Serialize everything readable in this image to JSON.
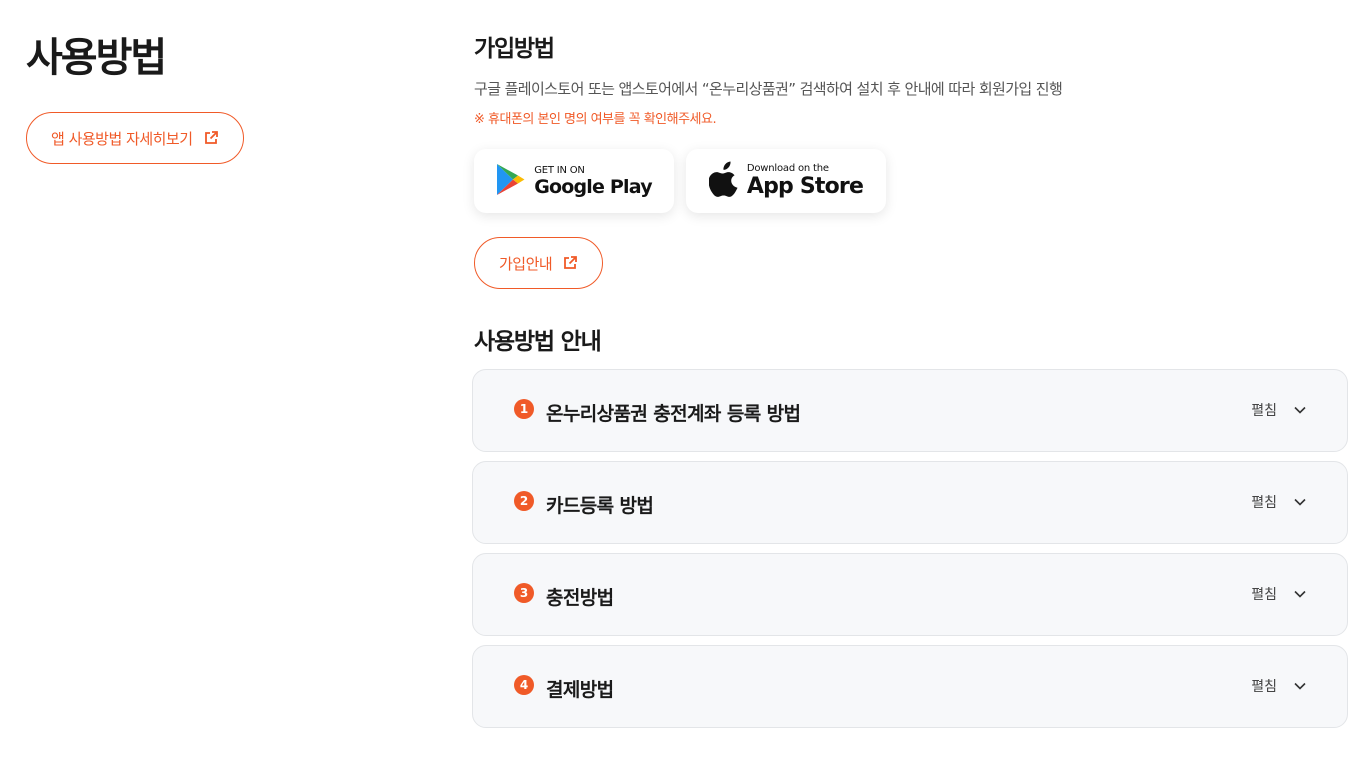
{
  "left": {
    "title": "사용방법",
    "detail_button": "앱 사용방법 자세히보기"
  },
  "signup": {
    "title": "가입방법",
    "description": "구글 플레이스토어 또는 앱스토어에서 “온누리상품권” 검색하여 설치 후 안내에 따라 회원가입 진행",
    "notice": "※ 휴대폰의 본인 명의 여부를 꼭 확인해주세요.",
    "google_play": {
      "small": "GET IN ON",
      "big": "Google Play"
    },
    "app_store": {
      "small": "Download on the",
      "big": "App Store"
    },
    "guide_button": "가입안내"
  },
  "guide": {
    "title": "사용방법 안내",
    "toggle_label": "펼침",
    "items": [
      {
        "number": "1",
        "title": "온누리상품권 충전계좌 등록 방법"
      },
      {
        "number": "2",
        "title": "카드등록 방법"
      },
      {
        "number": "3",
        "title": "충전방법"
      },
      {
        "number": "4",
        "title": "결제방법"
      }
    ]
  },
  "colors": {
    "accent": "#f05a28",
    "accordion_bg": "#f7f8fa",
    "accordion_border": "#e3e5e8"
  }
}
